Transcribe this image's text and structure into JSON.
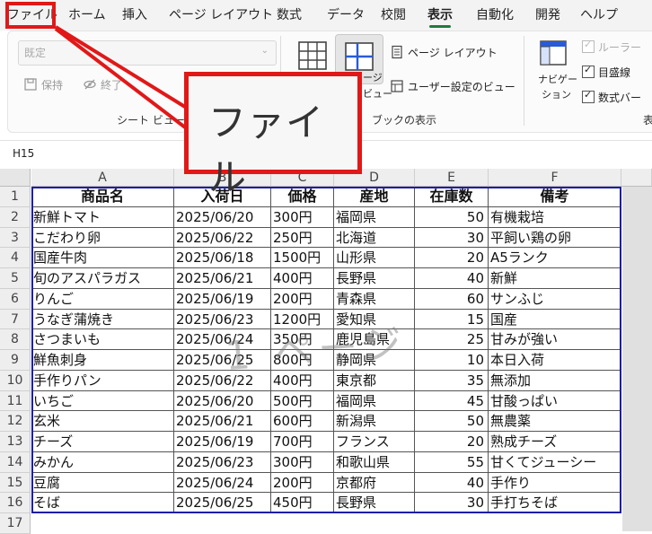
{
  "menu": {
    "items": [
      "ファイル",
      "ホーム",
      "挿入",
      "ページ レイアウト",
      "数式",
      "データ",
      "校閲",
      "表示",
      "自動化",
      "開発",
      "ヘルプ"
    ],
    "active_index": 7
  },
  "ribbon": {
    "sheet_view_dropdown": "既定",
    "keep_label": "保持",
    "exit_label": "終了",
    "sheet_view_group_label": "シート ビュー",
    "page_break_partial": "ージ",
    "page_break_partial2": "ビュー",
    "page_layout_label": "ページ レイアウト",
    "custom_view_label": "ユーザー設定のビュー",
    "workbook_view_group_label": "ブックの表示",
    "navigation_label": "ナビゲー",
    "navigation_label2": "ション",
    "ruler_label": "ルーラー",
    "gridlines_label": "目盛線",
    "formula_bar_label": "数式バー",
    "show_group_partial": "表"
  },
  "name_box": "H15",
  "columns": [
    "A",
    "B",
    "C",
    "D",
    "E",
    "F"
  ],
  "row_numbers": [
    "1",
    "2",
    "3",
    "4",
    "5",
    "6",
    "7",
    "8",
    "9",
    "10",
    "11",
    "12",
    "13",
    "14",
    "15",
    "16",
    "17"
  ],
  "table": {
    "headers": [
      "商品名",
      "入荷日",
      "価格",
      "産地",
      "在庫数",
      "備考"
    ],
    "rows": [
      [
        "新鮮トマト",
        "2025/06/20",
        "300円",
        "福岡県",
        "50",
        "有機栽培"
      ],
      [
        "こだわり卵",
        "2025/06/22",
        "250円",
        "北海道",
        "30",
        "平飼い鶏の卵"
      ],
      [
        "国産牛肉",
        "2025/06/18",
        "1500円",
        "山形県",
        "20",
        "A5ランク"
      ],
      [
        "旬のアスパラガス",
        "2025/06/21",
        "400円",
        "長野県",
        "40",
        "新鮮"
      ],
      [
        "りんご",
        "2025/06/19",
        "200円",
        "青森県",
        "60",
        "サンふじ"
      ],
      [
        "うなぎ蒲焼き",
        "2025/06/23",
        "1200円",
        "愛知県",
        "15",
        "国産"
      ],
      [
        "さつまいも",
        "2025/06/24",
        "350円",
        "鹿児島県",
        "25",
        "甘みが強い"
      ],
      [
        "鮮魚刺身",
        "2025/06/25",
        "800円",
        "静岡県",
        "10",
        "本日入荷"
      ],
      [
        "手作りパン",
        "2025/06/22",
        "400円",
        "東京都",
        "35",
        "無添加"
      ],
      [
        "いちご",
        "2025/06/20",
        "500円",
        "福岡県",
        "45",
        "甘酸っぱい"
      ],
      [
        "玄米",
        "2025/06/21",
        "600円",
        "新潟県",
        "50",
        "無農薬"
      ],
      [
        "チーズ",
        "2025/06/19",
        "700円",
        "フランス",
        "20",
        "熟成チーズ"
      ],
      [
        "みかん",
        "2025/06/23",
        "300円",
        "和歌山県",
        "55",
        "甘くてジューシー"
      ],
      [
        "豆腐",
        "2025/06/24",
        "200円",
        "京都府",
        "40",
        "手作り"
      ],
      [
        "そば",
        "2025/06/25",
        "450円",
        "長野県",
        "30",
        "手打ちそば"
      ]
    ]
  },
  "watermark": "1 ページ",
  "callout_text": "ファイル",
  "colors": {
    "highlight_red": "#e11818",
    "print_area_blue": "#1c1ea8",
    "active_tab_green": "#1f7a3d"
  }
}
